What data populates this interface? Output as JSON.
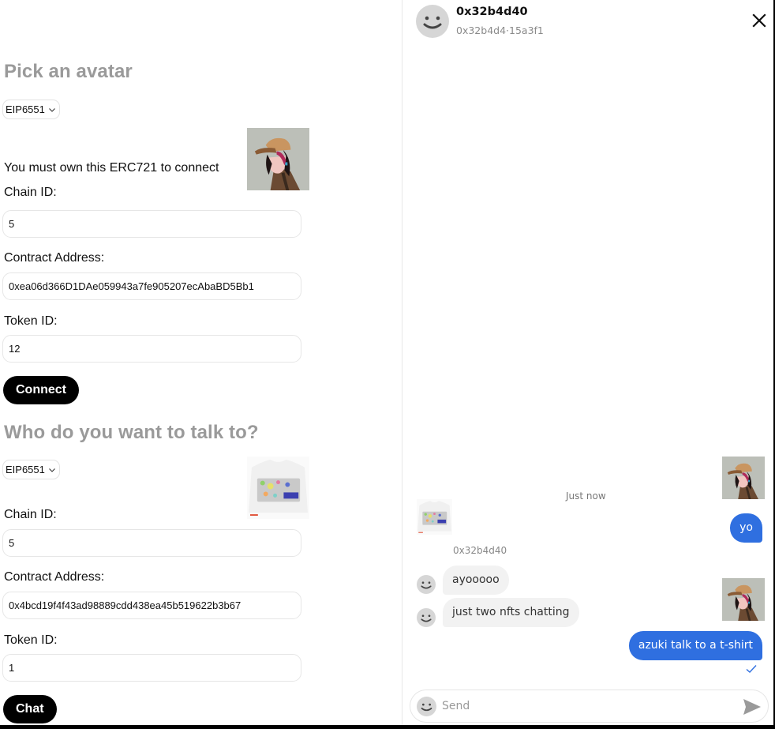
{
  "form": {
    "avatar_section": {
      "heading": "Pick an avatar",
      "standard_select": "EIP6551",
      "ownership_note": "You must own this ERC721 to connect",
      "chain_id_label": "Chain ID:",
      "chain_id_value": "5",
      "contract_label": "Contract Address:",
      "contract_value": "0xea06d366D1DAe059943a7fe905207ecAbaBD5Bb1",
      "token_label": "Token ID:",
      "token_value": "12",
      "button": "Connect",
      "nft_image": "azuki-avatar"
    },
    "recipient_section": {
      "heading": "Who do you want to talk to?",
      "standard_select": "EIP6551",
      "chain_id_label": "Chain ID:",
      "chain_id_value": "5",
      "contract_label": "Contract Address:",
      "contract_value": "0x4bcd19f4f43ad98889cdd438ea45b519622b3b67",
      "token_label": "Token ID:",
      "token_value": "1",
      "button": "Chat",
      "nft_image": "t-shirt"
    }
  },
  "chat": {
    "header": {
      "name": "0x32b4d40",
      "subtitle": "0x32b4d4·15a3f1",
      "close_icon": "close-icon"
    },
    "timestamp": "Just now",
    "other_sender": "0x32b4d40",
    "messages": [
      {
        "direction": "out",
        "text": "yo"
      },
      {
        "direction": "in",
        "text": "ayooooo"
      },
      {
        "direction": "in",
        "text": "just two nfts chatting"
      },
      {
        "direction": "out",
        "text": "azuki talk to a t-shirt",
        "status": "delivered"
      }
    ],
    "composer": {
      "placeholder": "Send",
      "value": ""
    },
    "colors": {
      "outgoing_bubble": "#2f6fe0",
      "incoming_bubble": "#f2f2f2",
      "heading_gray": "#9a9a9a"
    }
  }
}
